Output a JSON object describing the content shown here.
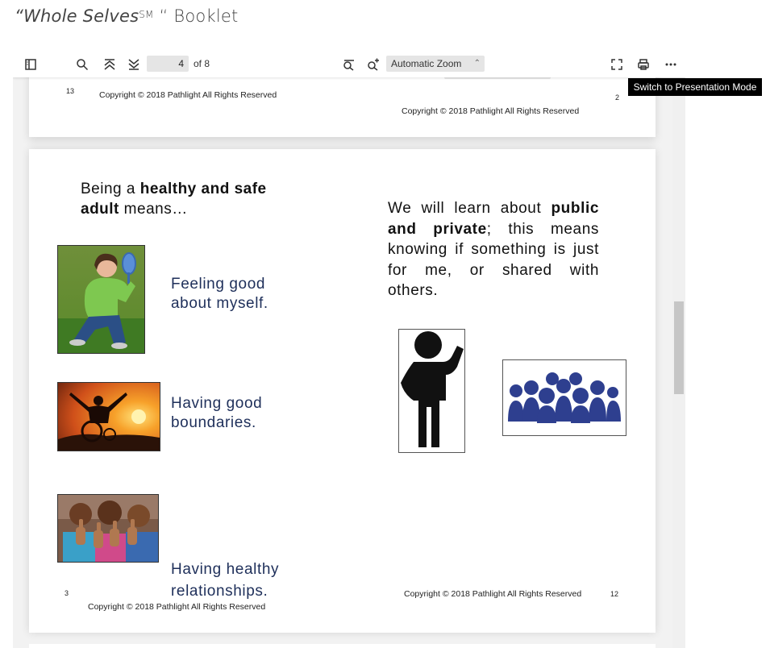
{
  "document": {
    "title_italic": "“Whole Selves",
    "title_mark": "SM",
    "title_rest": " “ Booklet"
  },
  "toolbar": {
    "page_current": "4",
    "page_of": "of 8",
    "zoom": "Automatic Zoom",
    "icons": [
      "sidebar-toggle-icon",
      "search-icon",
      "first-page-icon",
      "last-page-icon",
      "zoom-out-icon",
      "zoom-in-icon",
      "chevron-updown-icon",
      "presentation-mode-icon",
      "print-icon",
      "more-icon"
    ]
  },
  "tooltip": "Switch to Presentation Mode",
  "page_top": {
    "left_number": "13",
    "copyright_left": "Copyright © 2018 Pathlight All Rights Reserved",
    "right_number": "2",
    "copyright_right": "Copyright © 2018 Pathlight All Rights Reserved"
  },
  "page_main": {
    "left": {
      "heading_pre": "Being a ",
      "heading_bold": "healthy and safe adult",
      "heading_post": " means…",
      "items": [
        {
          "line1": "Feeling good",
          "line2": "about myself."
        },
        {
          "line1": "Having good",
          "line2": "boundaries."
        },
        {
          "line1": "Having healthy",
          "line2": "relationships."
        }
      ],
      "page_number": "3",
      "copyright": "Copyright © 2018 Pathlight All Rights Reserved"
    },
    "right": {
      "text_pre": "We will learn about ",
      "text_bold": "public and private",
      "text_post": "; this means knowing if something is just for me, or shared with others.",
      "page_number": "12",
      "copyright": "Copyright © 2018 Pathlight All Rights Reserved"
    }
  },
  "colors": {
    "caption": "#1e2f5a",
    "group_icon": "#2e3f8f"
  }
}
